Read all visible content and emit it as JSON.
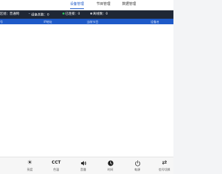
{
  "tabs": [
    {
      "label": "设备管理",
      "active": true
    },
    {
      "label": "节目管理",
      "active": false
    },
    {
      "label": "数据管理",
      "active": false
    }
  ],
  "status": {
    "group": "区组：普通网",
    "device_total": "设备总数：0",
    "online": "已连接：0",
    "offline": "离线数：0"
  },
  "table": {
    "columns": [
      "号",
      "IP地址",
      "当前节目",
      "设备名"
    ],
    "rows": []
  },
  "toolbar": [
    {
      "icon": "brightness-icon",
      "label": "亮度"
    },
    {
      "icon": "cct-icon",
      "glyph": "CCT",
      "label": "色温"
    },
    {
      "icon": "volume-icon",
      "label": "音量"
    },
    {
      "icon": "clock-icon",
      "label": "时间"
    },
    {
      "icon": "power-icon",
      "label": "电源"
    },
    {
      "icon": "input-switch-icon",
      "label": "信号切换"
    }
  ],
  "colors": {
    "accent": "#1e5ac8",
    "status_bar": "#1f2735",
    "online_dot": "#29c15a"
  }
}
